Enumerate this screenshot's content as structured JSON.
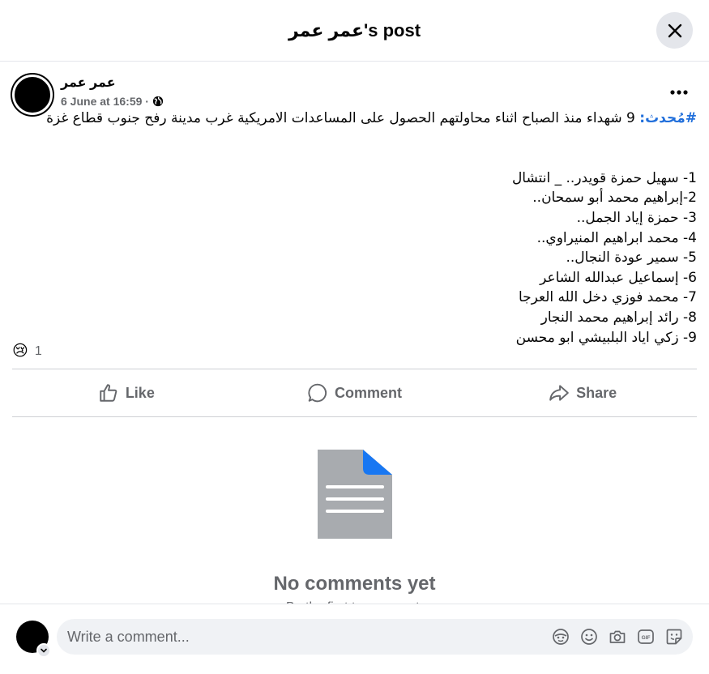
{
  "header": {
    "title": "عمر عمر's post"
  },
  "post": {
    "author": "عمر عمر",
    "timestamp": "6 June at 16:59 ·",
    "privacy_icon": "globe-icon",
    "hashtag": "#مُحدث:",
    "headline": " 9 شهداء منذ الصباح اثناء محاولتهم الحصول على المساعدات الامريكية غرب مدينة رفح جنوب قطاع غزة",
    "names": [
      "1- سهيل حمزة قويدر.. _ انتشال",
      "2-إبراهيم محمد أبو سمحان..",
      "3- حمزة إياد الجمل..",
      "4- محمد ابراهيم المنيراوي..",
      "5- سمير عودة النجال..",
      "6- إسماعيل عبدالله الشاعر",
      "7- محمد فوزي دخل الله العرجا",
      "8- رائد إبراهيم محمد النجار",
      "9- زكي اياد البلبيشي ابو محسن"
    ],
    "reaction_emoji": "😢",
    "reaction_count": "1"
  },
  "actions": {
    "like": "Like",
    "comment": "Comment",
    "share": "Share"
  },
  "comments": {
    "empty_title": "No comments yet",
    "empty_subtitle": "Be the first to comment."
  },
  "composer": {
    "placeholder": "Write a comment..."
  },
  "colors": {
    "accent": "#216fdb",
    "doc_icon": "#a8abaf",
    "doc_corner": "#1877f2",
    "secondary_text": "#65676b"
  }
}
